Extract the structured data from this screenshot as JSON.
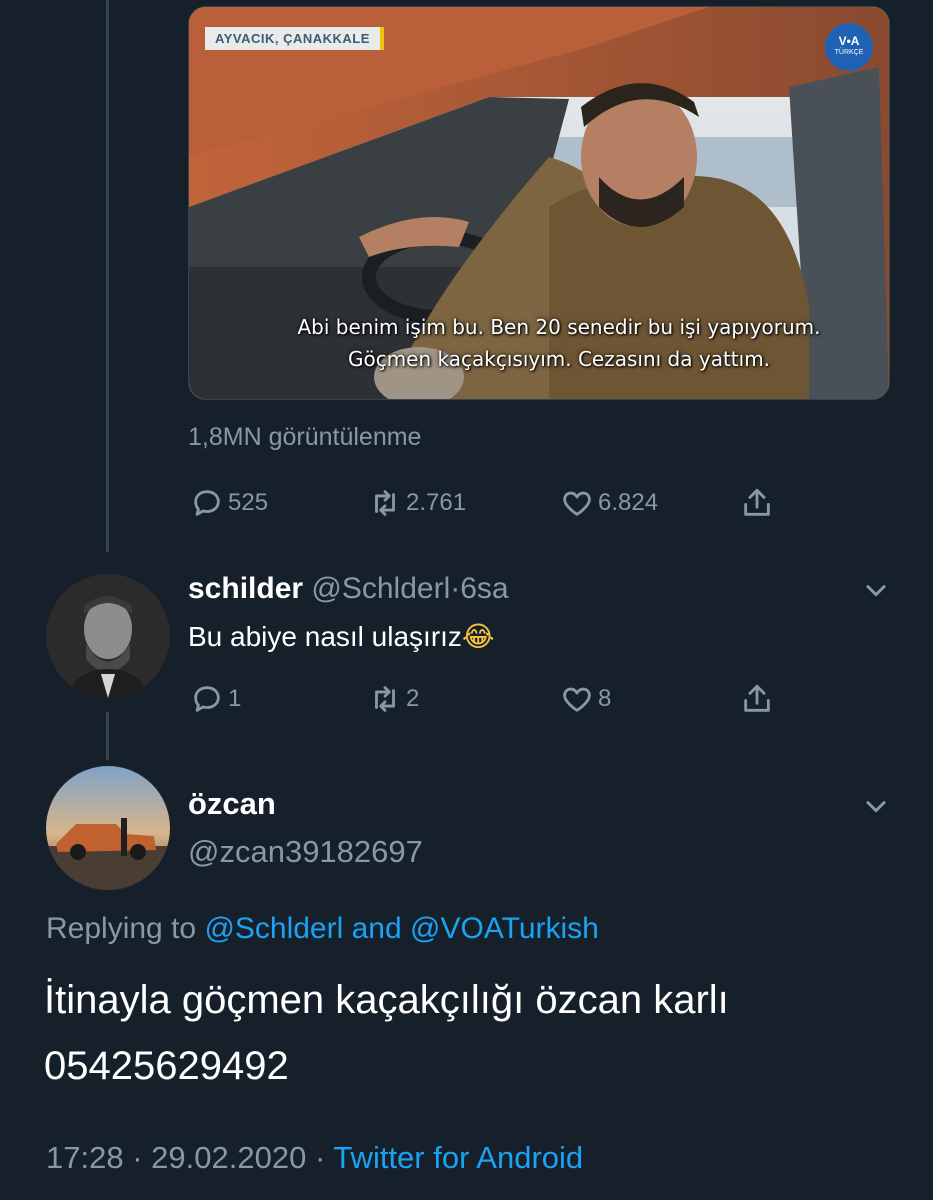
{
  "video": {
    "location_tag": "AYVACIK, ÇANAKKALE",
    "voa_logo": "V•A",
    "voa_sub": "TÜRKÇE",
    "subtitle_line1": "Abi benim işim bu. Ben 20 senedir bu işi yapıyorum.",
    "subtitle_line2": "Göçmen kaçakçısıyım. Cezasını da yattım."
  },
  "views": "1,8MN görüntülenme",
  "tweet_actions": {
    "replies": "525",
    "retweets": "2.761",
    "likes": "6.824"
  },
  "reply1": {
    "name": "schilder",
    "handle": "@Schlderl",
    "separator": "·",
    "time": "6sa",
    "text": "Bu abiye nasıl ulaşırız",
    "emoji": "😂",
    "replies": "1",
    "retweets": "2",
    "likes": "8"
  },
  "reply2": {
    "name": "özcan",
    "handle": "@zcan39182697",
    "replying_prefix": "Replying to",
    "replying_user1": "@Schlderl",
    "replying_and": "and",
    "replying_user2": "@VOATurkish",
    "text_line1": "İtinayla göçmen kaçakçılığı özcan karlı",
    "text_line2": "05425629492",
    "time": "17:28",
    "dot1": "·",
    "date": "29.02.2020",
    "dot2": "·",
    "source": "Twitter for Android"
  },
  "colors": {
    "background": "#15202b",
    "muted": "#8899a6",
    "link": "#1da1f2"
  },
  "icons": [
    "reply-icon",
    "retweet-icon",
    "like-icon",
    "share-icon",
    "chevron-down-icon"
  ]
}
